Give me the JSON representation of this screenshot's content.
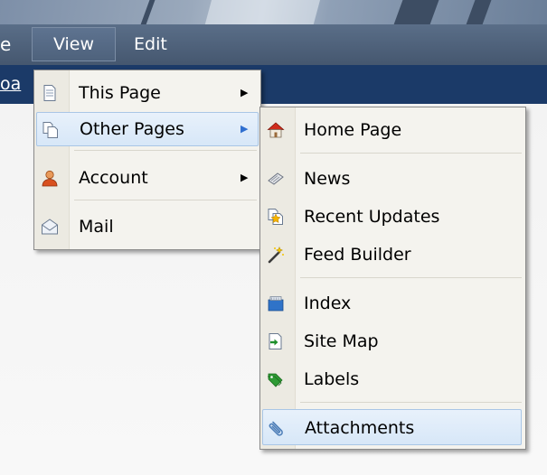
{
  "menubar": {
    "left_edge_text": "e",
    "view_label": "View",
    "edit_label": "Edit"
  },
  "navbar": {
    "left_edge_text": "oa"
  },
  "view_menu": {
    "items": [
      {
        "label": "This Page",
        "icon": "page-icon",
        "has_submenu": true
      },
      {
        "label": "Other Pages",
        "icon": "pages-icon",
        "has_submenu": true,
        "highlighted": true
      },
      {
        "label": "Account",
        "icon": "user-icon",
        "has_submenu": true
      },
      {
        "label": "Mail",
        "icon": "envelope-icon",
        "has_submenu": false
      }
    ]
  },
  "other_pages_menu": {
    "items": [
      {
        "label": "Home Page",
        "icon": "house-icon"
      },
      {
        "label": "News",
        "icon": "newspaper-icon"
      },
      {
        "label": "Recent Updates",
        "icon": "recent-updates-icon"
      },
      {
        "label": "Feed Builder",
        "icon": "magic-wand-icon"
      },
      {
        "label": "Index",
        "icon": "index-box-icon"
      },
      {
        "label": "Site Map",
        "icon": "site-map-icon"
      },
      {
        "label": "Labels",
        "icon": "labels-icon"
      },
      {
        "label": "Attachments",
        "icon": "paperclip-icon",
        "highlighted": true
      }
    ]
  },
  "colors": {
    "menubar": "#4f627c",
    "navbar": "#1b3a68",
    "menu_bg": "#f4f3ee",
    "highlight": "#d7e7f8",
    "highlight_border": "#a9c6e6"
  }
}
